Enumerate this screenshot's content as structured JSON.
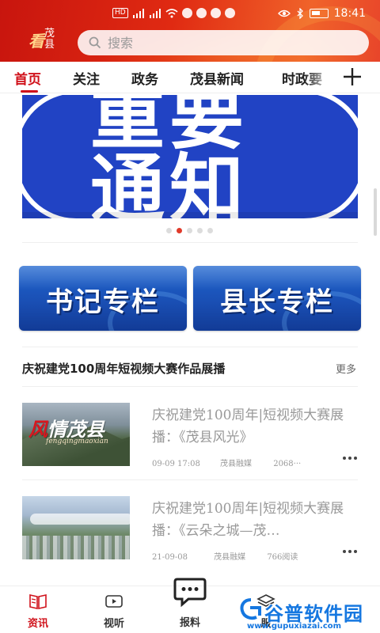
{
  "status_bar": {
    "network_tags": [
      "HD",
      "4G"
    ],
    "time": "18:41"
  },
  "header": {
    "logo_text": "茂县",
    "search": {
      "placeholder": "搜索"
    }
  },
  "tabs": [
    {
      "label": "首页",
      "active": true
    },
    {
      "label": "关注",
      "active": false
    },
    {
      "label": "政务",
      "active": false
    },
    {
      "label": "茂县新闻",
      "active": false
    },
    {
      "label": "时政要",
      "active": false
    }
  ],
  "banner": {
    "line1": "重要",
    "line2": "通知",
    "page_count": 5,
    "active_page": 2
  },
  "columns": [
    {
      "label": "书记专栏"
    },
    {
      "label": "县长专栏"
    }
  ],
  "section": {
    "title": "庆祝建党100周年短视频大赛作品展播",
    "more": "更多"
  },
  "news": [
    {
      "title": "庆祝建党100周年|短视频大赛展播：《茂县风光》",
      "date": "09-09 17:08",
      "source": "茂县融媒",
      "reads": "2068···",
      "thumb_caption_a": "风",
      "thumb_caption_b": "情茂县",
      "thumb_sub": "fengqingmaoxian"
    },
    {
      "title": "庆祝建党100周年|短视频大赛展播：《云朵之城—茂…",
      "date": "21-09-08",
      "source": "茂县融媒",
      "reads": "766阅读"
    }
  ],
  "bottom_nav": [
    {
      "label": "资讯",
      "icon": "news-book-icon",
      "active": true
    },
    {
      "label": "视听",
      "icon": "tv-play-icon",
      "active": false
    },
    {
      "label": "报料",
      "icon": "chat-report-icon",
      "active": false
    },
    {
      "label": "服",
      "icon": "layers-icon",
      "active": false
    }
  ],
  "watermark": {
    "text": "谷普软件园",
    "url": "www.gupuxiazai.com"
  },
  "colors": {
    "brand_red": "#d0121b",
    "banner_blue": "#2143c4",
    "column_blue": "#1a4fb4",
    "watermark_blue": "#1577e0"
  }
}
